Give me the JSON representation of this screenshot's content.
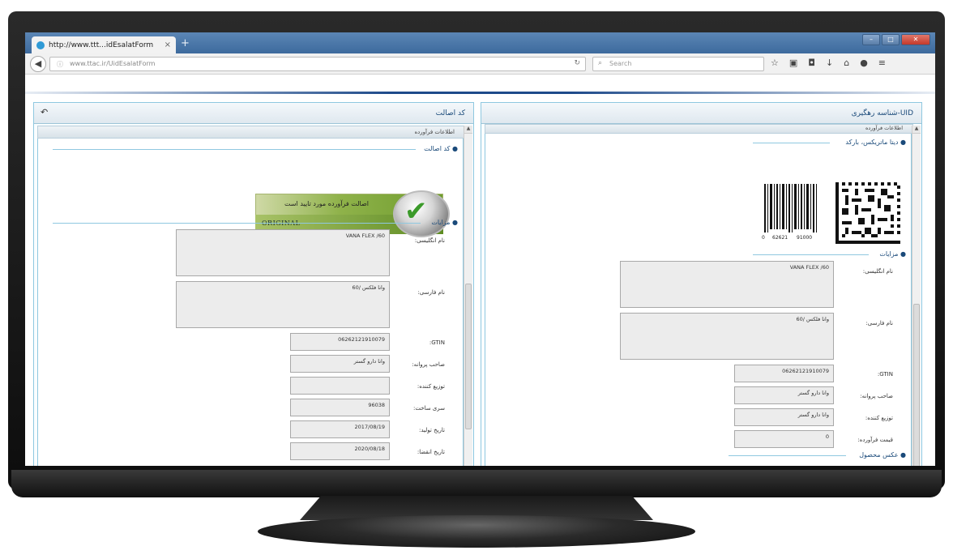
{
  "browser": {
    "tab_title": "http://www.ttt...idEsalatForm",
    "tab_close": "×",
    "new_tab": "+",
    "url": "www.ttac.ir/UidEsalatForm",
    "search_placeholder": "Search",
    "window_buttons": [
      "–",
      "□",
      "✕"
    ]
  },
  "left_panel": {
    "title": "کد اصالت",
    "subtitle": "اطلاعات فرآورده",
    "auth_section": "کد اصالت",
    "auth_message": "اصالت فرآورده مورد تایید است",
    "auth_badge": "ORIGINAL",
    "details_section": "مزایات",
    "fields": [
      {
        "label": "نام انگلیسی:",
        "value": "VANA FLEX /60"
      },
      {
        "label": "نام فارسی:",
        "value": "وانا فلکس /60"
      },
      {
        "label": "GTIN:",
        "value": "06262121910079"
      },
      {
        "label": "صاحب پروانه:",
        "value": "وانا دارو گستر"
      },
      {
        "label": "توزیع کننده:",
        "value": ""
      },
      {
        "label": "سری ساخت:",
        "value": "96038"
      },
      {
        "label": "تاریخ تولید:",
        "value": "2017/08/19"
      },
      {
        "label": "تاریخ انقضا:",
        "value": "2020/08/18"
      }
    ]
  },
  "right_panel": {
    "title": "شناسه رهگیری-UID",
    "subtitle": "اطلاعات فرآورده",
    "barcode_section": "دیتا ماتریکس، بارکد",
    "barcode_digits": [
      "0",
      "62621",
      "91000"
    ],
    "details_section": "مزایات",
    "photo_section": "عکس محصول",
    "fields": [
      {
        "label": "نام انگلیسی:",
        "value": "VANA FLEX /60"
      },
      {
        "label": "نام فارسی:",
        "value": "وانا فلکس /60"
      },
      {
        "label": "GTIN:",
        "value": "06262121910079"
      },
      {
        "label": "صاحب پروانه:",
        "value": "وانا دارو گستر"
      },
      {
        "label": "توزیع کننده:",
        "value": "وانا دارو گستر"
      },
      {
        "label": "قیمت فرآورده:",
        "value": "0"
      }
    ]
  },
  "icons": {
    "back": "arrow-left-icon",
    "refresh": "refresh-icon",
    "undo": "undo-icon",
    "check": "check-icon"
  }
}
